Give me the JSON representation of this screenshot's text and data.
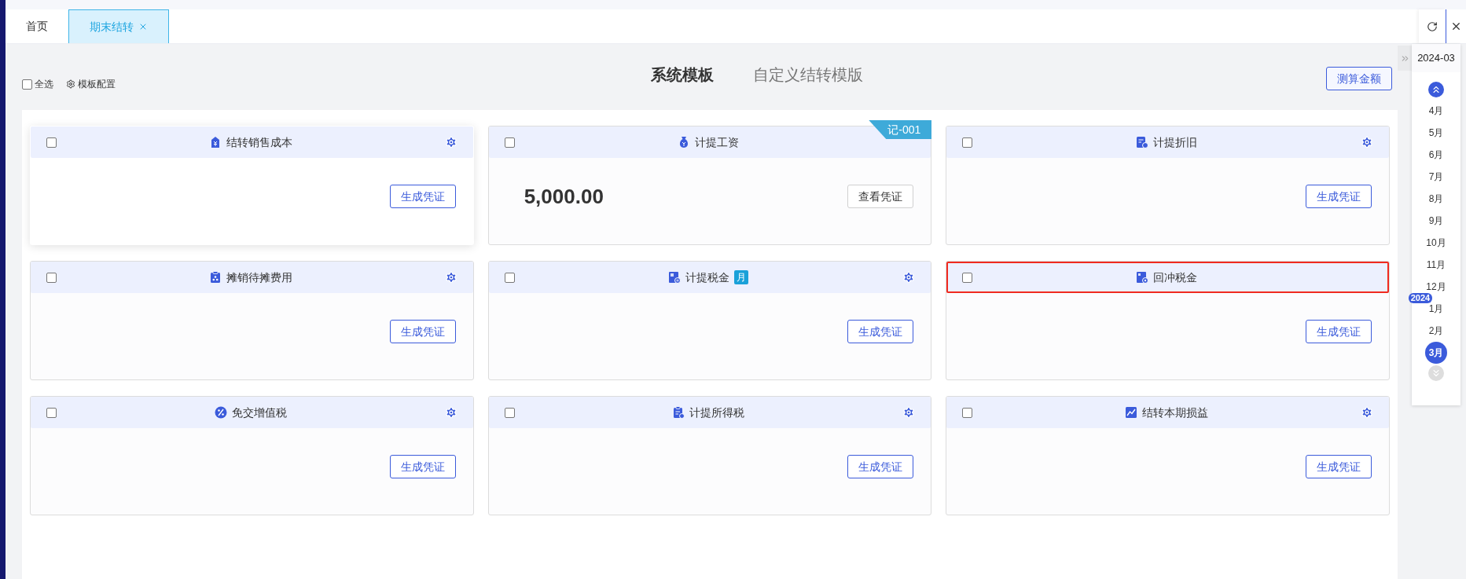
{
  "tabs": [
    {
      "label": "首页",
      "selected": false,
      "closable": false
    },
    {
      "label": "期末结转",
      "selected": true,
      "closable": true
    }
  ],
  "template_tabs": [
    {
      "label": "系统模板",
      "selected": true
    },
    {
      "label": "自定义结转模版",
      "selected": false
    }
  ],
  "toolbar": {
    "select_all": {
      "label": "全选",
      "checked": false
    },
    "config_label": "模板配置",
    "estimate_button": "测算金额"
  },
  "cards": [
    {
      "title": "结转销售成本",
      "kind": "tag",
      "checked": false,
      "settings": true,
      "hovered": true,
      "highlighted": false,
      "button": {
        "label": "生成凭证",
        "kind": "primary"
      }
    },
    {
      "title": "计提工资",
      "kind": "moneybag",
      "checked": false,
      "settings": false,
      "hovered": false,
      "highlighted": false,
      "voucher": "记-001",
      "amount": "5,000.00",
      "button": {
        "label": "查看凭证",
        "kind": "plain"
      }
    },
    {
      "title": "计提折旧",
      "kind": "document",
      "checked": false,
      "settings": true,
      "hovered": false,
      "highlighted": false,
      "button": {
        "label": "生成凭证",
        "kind": "primary"
      }
    },
    {
      "title": "摊销待摊费用",
      "kind": "box",
      "checked": false,
      "settings": true,
      "hovered": false,
      "highlighted": false,
      "button": {
        "label": "生成凭证",
        "kind": "primary"
      }
    },
    {
      "title": "计提税金",
      "kind": "tax",
      "badge": "月",
      "checked": false,
      "settings": true,
      "hovered": false,
      "highlighted": false,
      "button": {
        "label": "生成凭证",
        "kind": "primary"
      }
    },
    {
      "title": "回冲税金",
      "kind": "refund",
      "checked": false,
      "settings": false,
      "hovered": false,
      "highlighted": true,
      "button": {
        "label": "生成凭证",
        "kind": "primary"
      }
    },
    {
      "title": "免交增值税",
      "kind": "percent",
      "checked": false,
      "settings": true,
      "hovered": false,
      "highlighted": false,
      "button": {
        "label": "生成凭证",
        "kind": "primary"
      }
    },
    {
      "title": "计提所得税",
      "kind": "clipboard",
      "checked": false,
      "settings": true,
      "hovered": false,
      "highlighted": false,
      "button": {
        "label": "生成凭证",
        "kind": "primary"
      }
    },
    {
      "title": "结转本期损益",
      "kind": "chart",
      "checked": false,
      "settings": true,
      "hovered": false,
      "highlighted": false,
      "button": {
        "label": "生成凭证",
        "kind": "primary"
      }
    }
  ],
  "period_panel": {
    "current": "2024-03",
    "months": [
      {
        "label": "4月",
        "selected": false
      },
      {
        "label": "5月",
        "selected": false
      },
      {
        "label": "6月",
        "selected": false
      },
      {
        "label": "7月",
        "selected": false
      },
      {
        "label": "8月",
        "selected": false
      },
      {
        "label": "9月",
        "selected": false
      },
      {
        "label": "10月",
        "selected": false
      },
      {
        "label": "11月",
        "selected": false
      },
      {
        "label": "12月",
        "selected": false
      },
      {
        "label": "1月",
        "selected": false,
        "year_badge": "2024"
      },
      {
        "label": "2月",
        "selected": false
      },
      {
        "label": "3月",
        "selected": true
      }
    ]
  }
}
